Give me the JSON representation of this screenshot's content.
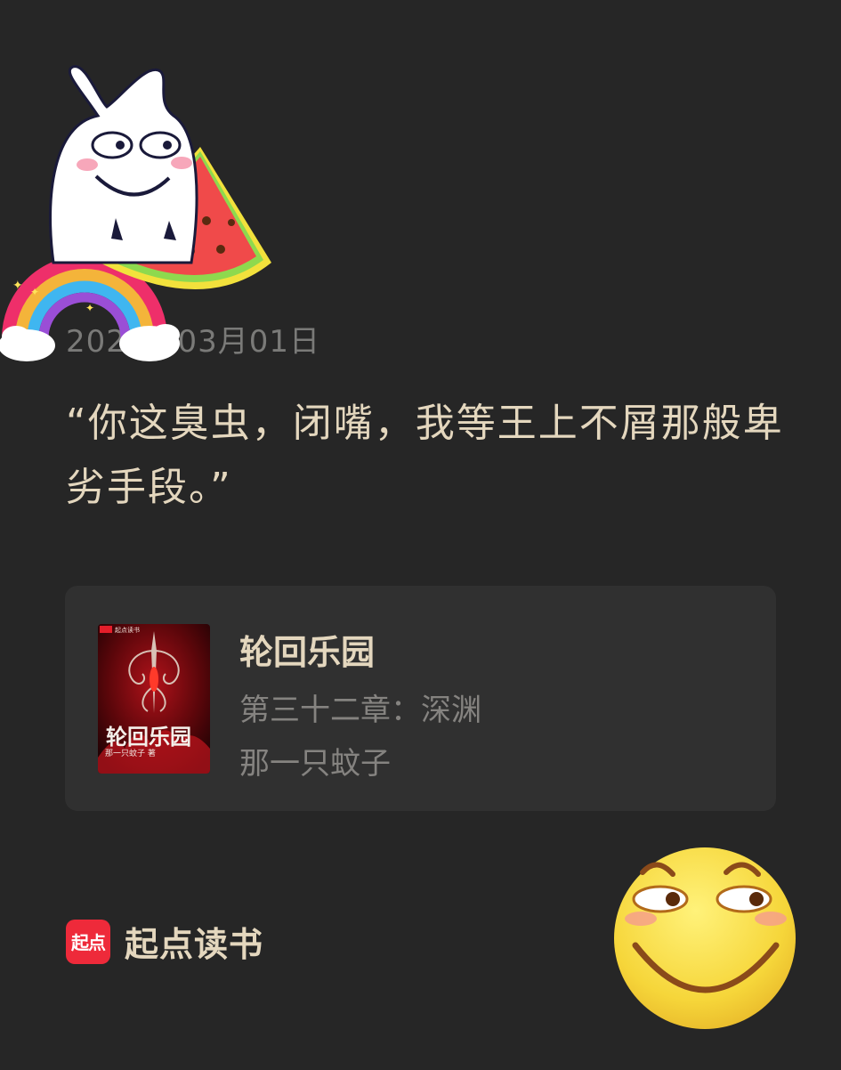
{
  "post": {
    "date": "2022年03月01日",
    "quote": "“你这臭虫，闭嘴，我等王上不屑那般卑劣手段。”"
  },
  "book": {
    "title": "轮回乐园",
    "chapter": "第三十二章：深渊",
    "author": "那一只蚊子",
    "cover": {
      "badge": "起点读书",
      "title": "轮回乐园",
      "author_line": "那一只蚊子 著"
    }
  },
  "brand": {
    "logo_text": "起点",
    "name": "起点读书"
  },
  "stickers": {
    "top_left": [
      "white-bunny-icon",
      "watermelon-icon",
      "rainbow-icon"
    ],
    "bottom_right": "grinning-face-icon"
  },
  "colors": {
    "background": "#262626",
    "card": "#303030",
    "text_primary": "#e4d7be",
    "text_secondary": "#858380",
    "brand_red": "#ee2a3a"
  }
}
